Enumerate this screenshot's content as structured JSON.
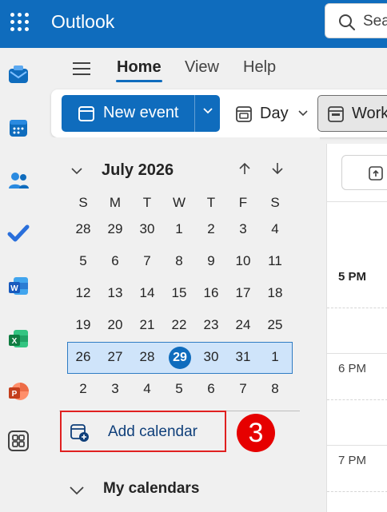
{
  "header": {
    "app_title": "Outlook",
    "search_placeholder": "Sea",
    "brand_color": "#0f6cbd"
  },
  "rail": {
    "icons": [
      "mail-icon",
      "calendar-icon",
      "people-icon",
      "todo-icon",
      "word-icon",
      "excel-icon",
      "powerpoint-icon",
      "more-apps-icon"
    ]
  },
  "ribbon": {
    "tabs": [
      {
        "label": "Home",
        "active": true
      },
      {
        "label": "View",
        "active": false
      },
      {
        "label": "Help",
        "active": false
      }
    ]
  },
  "toolbar": {
    "new_event_label": "New event",
    "view_label": "Day",
    "work_week_label": "Work"
  },
  "mini_calendar": {
    "month_label": "July 2026",
    "weekdays": [
      "S",
      "M",
      "T",
      "W",
      "T",
      "F",
      "S"
    ],
    "weeks": [
      [
        "28",
        "29",
        "30",
        "1",
        "2",
        "3",
        "4"
      ],
      [
        "5",
        "6",
        "7",
        "8",
        "9",
        "10",
        "11"
      ],
      [
        "12",
        "13",
        "14",
        "15",
        "16",
        "17",
        "18"
      ],
      [
        "19",
        "20",
        "21",
        "22",
        "23",
        "24",
        "25"
      ],
      [
        "26",
        "27",
        "28",
        "29",
        "30",
        "31",
        "1"
      ],
      [
        "2",
        "3",
        "4",
        "5",
        "6",
        "7",
        "8"
      ]
    ],
    "today": "29"
  },
  "add_calendar_label": "Add calendar",
  "step_badge": "3",
  "my_calendars_label": "My calendars",
  "day_view": {
    "hours": [
      "5 PM",
      "6 PM",
      "7 PM"
    ]
  }
}
